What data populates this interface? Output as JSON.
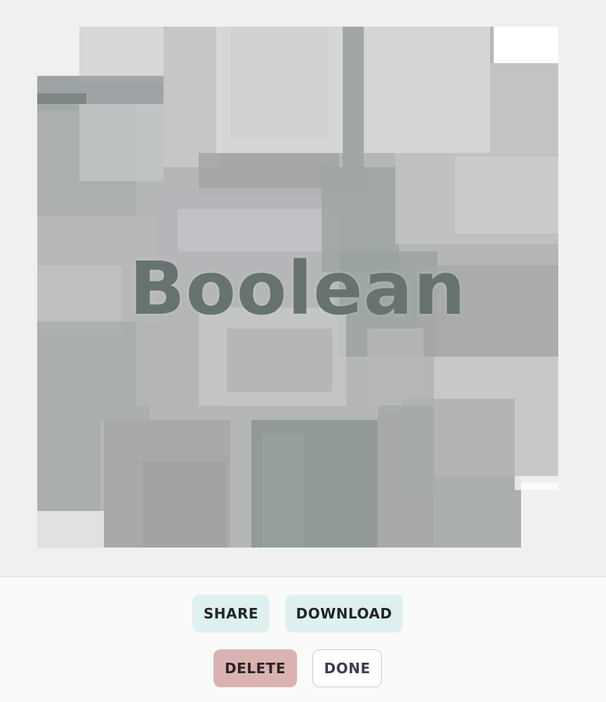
{
  "artwork": {
    "title": "Boolean"
  },
  "actions": {
    "share_label": "SHARE",
    "download_label": "DOWNLOAD",
    "delete_label": "DELETE",
    "done_label": "DONE"
  },
  "colors": {
    "page_background": "#f0f0f0",
    "toolbar_background": "#fafafa",
    "primary_button": "#dff0f0",
    "danger_button": "#dbb2b2",
    "title_text": "#677370"
  }
}
